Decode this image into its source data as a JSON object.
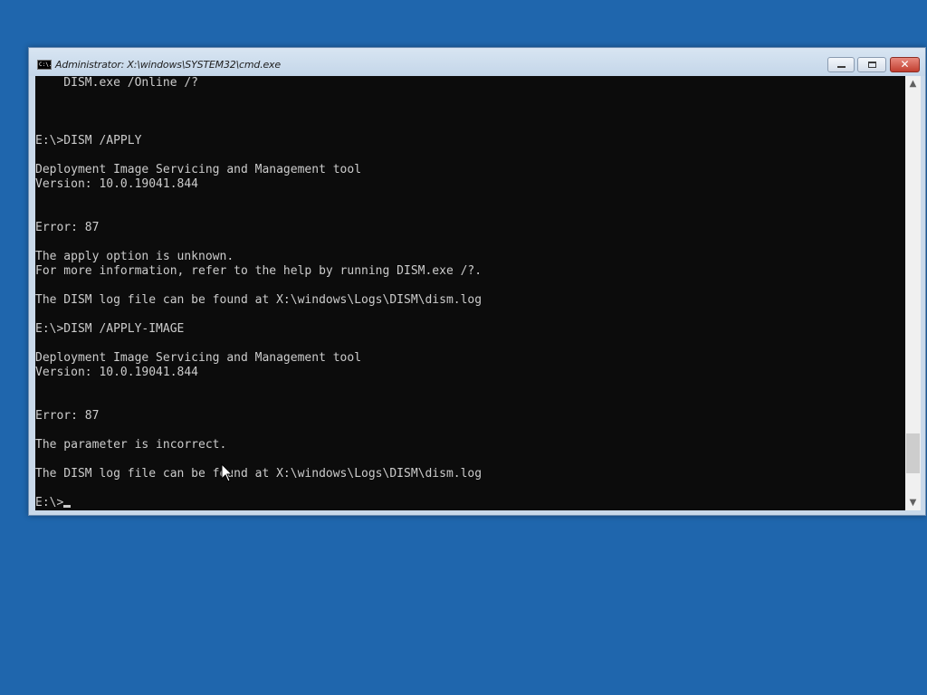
{
  "window": {
    "title": "Administrator: X:\\windows\\SYSTEM32\\cmd.exe",
    "icon": "cmd-icon",
    "icon_text": "C:\\."
  },
  "controls": {
    "minimize_icon": "minimize-icon",
    "maximize_icon": "maximize-icon",
    "close_icon": "close-icon",
    "close_glyph": "✕"
  },
  "console": {
    "lines": [
      "    DISM.exe /Online /?",
      "",
      "",
      "",
      "E:\\>DISM /APPLY",
      "",
      "Deployment Image Servicing and Management tool",
      "Version: 10.0.19041.844",
      "",
      "",
      "Error: 87",
      "",
      "The apply option is unknown.",
      "For more information, refer to the help by running DISM.exe /?.",
      "",
      "The DISM log file can be found at X:\\windows\\Logs\\DISM\\dism.log",
      "",
      "E:\\>DISM /APPLY-IMAGE",
      "",
      "Deployment Image Servicing and Management tool",
      "Version: 10.0.19041.844",
      "",
      "",
      "Error: 87",
      "",
      "The parameter is incorrect.",
      "",
      "The DISM log file can be found at X:\\windows\\Logs\\DISM\\dism.log",
      "",
      "E:\\>"
    ]
  },
  "scrollbar": {
    "up_glyph": "▲",
    "down_glyph": "▼",
    "position": 0.94
  },
  "colors": {
    "desktop": "#1f66ad",
    "console_bg": "#0c0c0c",
    "console_fg": "#cccccc"
  }
}
